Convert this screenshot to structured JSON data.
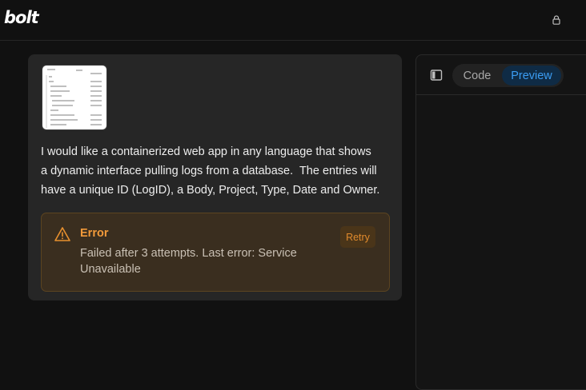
{
  "header": {
    "logo_text": "bolt",
    "lock_icon": "lock-icon"
  },
  "chat": {
    "attachment": {
      "type": "image-thumbnail",
      "icon": "document-thumbnail"
    },
    "message": "I would like a containerized web app in any language that shows\na dynamic interface pulling logs from a database.  The entries will\nhave a unique ID (LogID), a Body, Project, Type, Date and Owner.",
    "error": {
      "icon": "warning-triangle-icon",
      "title": "Error",
      "message": "Failed after 3 attempts. Last error: Service Unavailable",
      "retry_label": "Retry",
      "accent_color": "#f29a3a"
    }
  },
  "preview_panel": {
    "sidebar_toggle_icon": "sidebar-toggle-icon",
    "tabs": [
      {
        "label": "Code",
        "active": false
      },
      {
        "label": "Preview",
        "active": true
      }
    ],
    "active_tab_color": "#3b9cf2"
  }
}
